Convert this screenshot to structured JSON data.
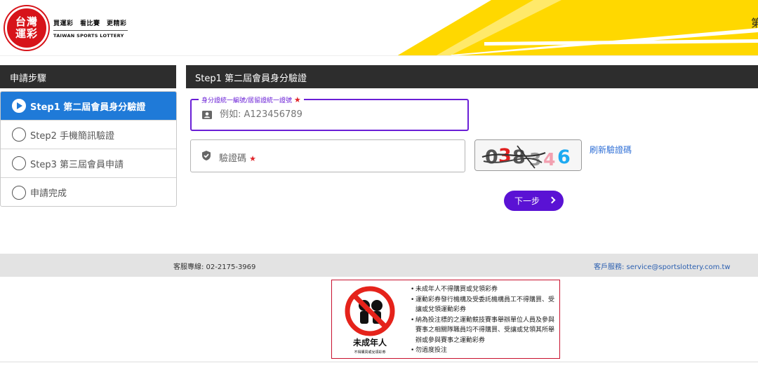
{
  "header": {
    "logo_text_top": "台灣",
    "logo_text_bottom": "運彩",
    "slogan": "買運彩　看比賽　更精彩",
    "brand_en": "TAIWAN SPORTS LOTTERY",
    "right_text": "第",
    "stripe_color": "#ffd800",
    "brand_color": "#d7141a"
  },
  "sidebar": {
    "title": "申請步驟",
    "steps": [
      {
        "label": "Step1 第二屆會員身分驗證",
        "active": true
      },
      {
        "label": "Step2 手機簡訊驗證",
        "active": false
      },
      {
        "label": "Step3 第三屆會員申請",
        "active": false
      },
      {
        "label": "申請完成",
        "active": false
      }
    ],
    "active_color": "#1f7ad8"
  },
  "main": {
    "title": "Step1 第二屆會員身分驗證",
    "id_field": {
      "label": "身分證統一編號/居留證統一證號",
      "required_mark": "★",
      "placeholder": "例如: A123456789",
      "icon": "id-card-icon"
    },
    "captcha_field": {
      "placeholder": "驗證碼",
      "required_mark": "★",
      "icon": "shield-check-icon"
    },
    "captcha_image": {
      "chars": [
        "0",
        "3",
        "8",
        "3",
        "4",
        "6"
      ],
      "colors": [
        "#555555",
        "#e02020",
        "#555555",
        "#999999",
        "#f2a0b0",
        "#1eaaf1"
      ]
    },
    "refresh_label": "刷新驗證碼",
    "next_label": "下一步",
    "accent_color": "#5a12d4"
  },
  "footer": {
    "hotline": "客服專線: 02-2175-3969",
    "service": "客戶服務: service@sportslottery.com.tw",
    "notice": {
      "sign_title": "未成年人",
      "sign_subtitle": "不得購買或兌領彩券",
      "items": [
        "未成年人不得購買或兌領彩券",
        "運動彩券發行機構及受委託機構員工不得購買、受讓或兌領運動彩券",
        "納為投注標的之運動競技賽事舉辦單位人員及參與賽事之相關隊職員均不得購買、受讓或兌領其所舉辦或參與賽事之運動彩券",
        "勿過度投注"
      ]
    }
  }
}
